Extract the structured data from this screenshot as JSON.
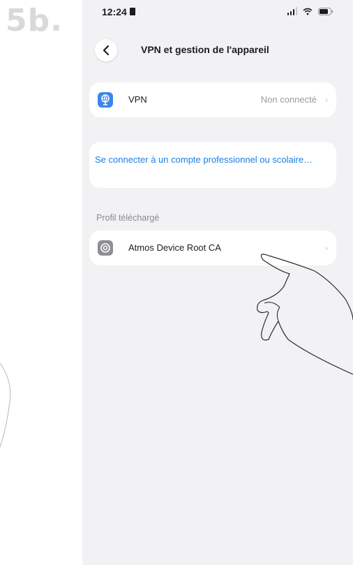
{
  "step": {
    "label": "5b."
  },
  "status_bar": {
    "time": "12:24"
  },
  "nav": {
    "title": "VPN et gestion de l'appareil",
    "back_icon": "chevron-left-icon"
  },
  "vpn_row": {
    "label": "VPN",
    "value": "Non connecté",
    "icon": "vpn-globe-icon",
    "icon_color": "#3a86f0"
  },
  "work_account": {
    "link_text": "Se connecter à un compte professionnel ou scolaire…",
    "link_color": "#1a7ee6"
  },
  "profile_section": {
    "header": "Profil téléchargé",
    "items": [
      {
        "label": "Atmos Device Root CA",
        "icon": "settings-gear-icon"
      }
    ]
  }
}
